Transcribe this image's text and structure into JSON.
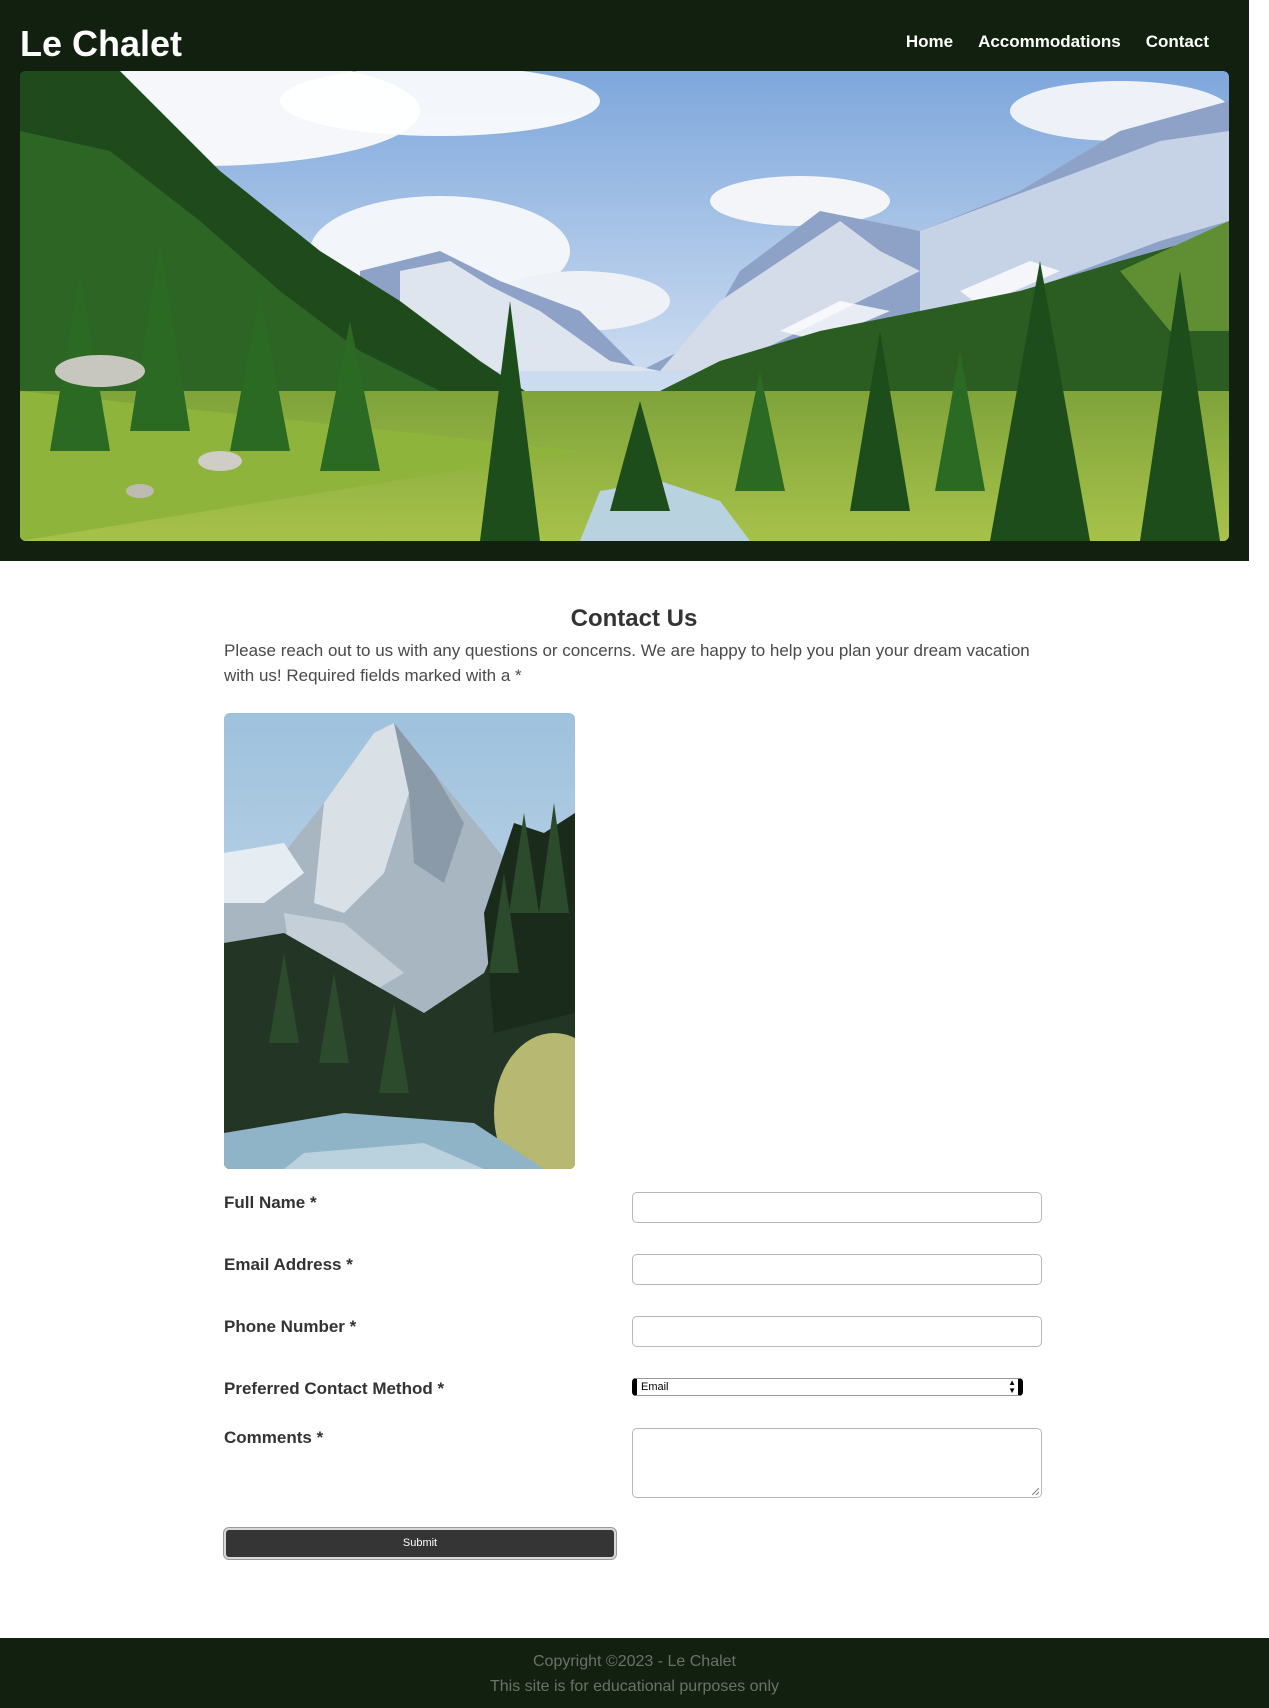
{
  "header": {
    "brand": "Le Chalet",
    "nav": [
      "Home",
      "Accommodations",
      "Contact"
    ]
  },
  "main": {
    "title": "Contact Us",
    "intro": "Please reach out to us with any questions or concerns. We are happy to help you plan your dream vacation with us! Required fields marked with a *"
  },
  "form": {
    "full_name_label": "Full Name *",
    "email_label": "Email Address *",
    "phone_label": "Phone Number *",
    "contact_method_label": "Preferred Contact Method *",
    "contact_method_value": "Email",
    "comments_label": "Comments *",
    "submit_label": "Submit"
  },
  "footer": {
    "copyright": "Copyright ©2023 - Le Chalet",
    "note": "This site is for educational purposes only"
  },
  "colors": {
    "header_bg": "#12210f",
    "button_bg": "#353535",
    "text": "#333333"
  }
}
